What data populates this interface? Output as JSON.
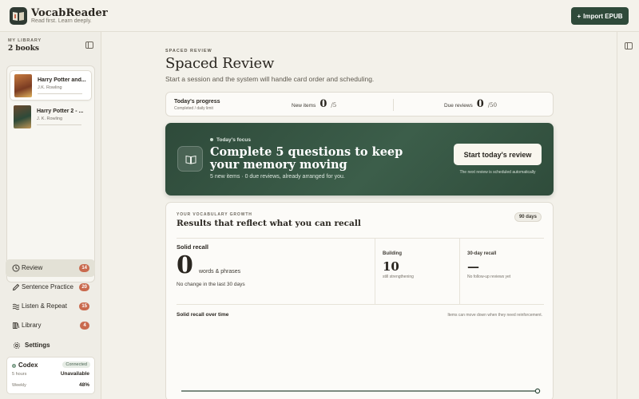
{
  "app": {
    "name": "VocabReader",
    "tagline": "Read first. Learn deeply.",
    "import_label": "Import EPUB"
  },
  "sidebar": {
    "library_label": "MY LIBRARY",
    "library_count": "2 books",
    "books": [
      {
        "title": "Harry Potter and...",
        "author": "J.K. Rowling",
        "active": true
      },
      {
        "title": "Harry Potter 2 - ...",
        "author": "J. K. Rowling",
        "active": false
      }
    ],
    "nav": [
      {
        "label": "Review",
        "badge": "14",
        "icon": "review-icon",
        "active": true
      },
      {
        "label": "Sentence Practice",
        "badge": "20",
        "icon": "pen-icon",
        "active": false
      },
      {
        "label": "Listen & Repeat",
        "badge": "15",
        "icon": "audio-icon",
        "active": false
      },
      {
        "label": "Library",
        "badge": "4",
        "icon": "library-icon",
        "active": false
      }
    ],
    "settings_label": "Settings",
    "codex": {
      "name": "Codex",
      "status": "Connected",
      "row1_label": "5 hours",
      "row1_value": "Unavailable",
      "row2_label": "Weekly",
      "row2_value": "48%"
    }
  },
  "main": {
    "kicker": "SPACED REVIEW",
    "title": "Spaced Review",
    "subtitle": "Start a session and the system will handle card order and scheduling.",
    "progress": {
      "label": "Today's progress",
      "sub": "Completed / daily limit",
      "new_label": "New items",
      "new_value": "0",
      "new_total": "/5",
      "due_label": "Due reviews",
      "due_value": "0",
      "due_total": "/50"
    },
    "focus": {
      "kicker": "Today's focus",
      "title": "Complete 5 questions to keep your memory moving",
      "sub": "5 new items · 0 due reviews, already arranged for you.",
      "button": "Start today's review",
      "note": "The next review is scheduled automatically"
    },
    "growth": {
      "kicker": "YOUR VOCABULARY GROWTH",
      "title": "Results that reflect what you can recall",
      "badge": "90 days",
      "solid_label": "Solid recall",
      "solid_value": "0",
      "solid_unit": "words & phrases",
      "solid_note": "No change in the last 30 days",
      "building_label": "Building",
      "building_value": "10",
      "building_sub": "still strengthening",
      "recall30_label": "30-day recall",
      "recall30_value": "—",
      "recall30_sub": "No follow-up reviews yet",
      "chart_title": "Solid recall over time",
      "chart_note": "Items can move down when they need reinforcement."
    }
  },
  "colors": {
    "accent": "#2f4a3a",
    "badge": "#c96a4e"
  }
}
